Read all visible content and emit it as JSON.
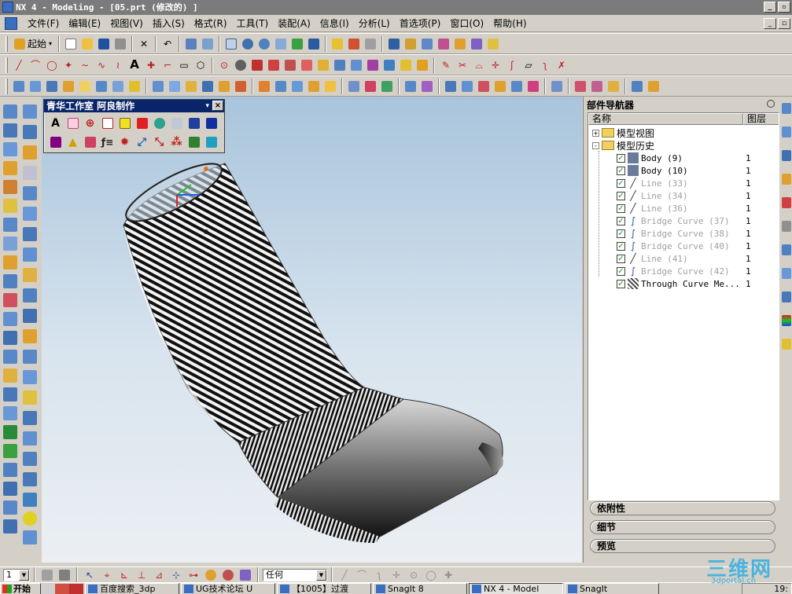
{
  "window": {
    "title": "NX 4 - Modeling - [05.prt (修改的) ]",
    "minimize_label": "_",
    "restore_label": "▫"
  },
  "menu": {
    "items": [
      {
        "label": "文件(F)"
      },
      {
        "label": "编辑(E)"
      },
      {
        "label": "视图(V)"
      },
      {
        "label": "插入(S)"
      },
      {
        "label": "格式(R)"
      },
      {
        "label": "工具(T)"
      },
      {
        "label": "装配(A)"
      },
      {
        "label": "信息(I)"
      },
      {
        "label": "分析(L)"
      },
      {
        "label": "首选项(P)"
      },
      {
        "label": "窗口(O)"
      },
      {
        "label": "帮助(H)"
      }
    ]
  },
  "toolbar": {
    "start_label": "起始",
    "text_tool_label": "A"
  },
  "floating_palette": {
    "title": "青华工作室 阿良制作",
    "text_tool_label": "A",
    "close_label": "×",
    "dropdown_label": "▾"
  },
  "navigator": {
    "title": "部件导航器",
    "columns": {
      "name": "名称",
      "layer": "图层"
    },
    "tree": [
      {
        "label": "模型视图",
        "kind": "folder",
        "expander": "+",
        "level": 0,
        "layer": "",
        "dim": false
      },
      {
        "label": "模型历史",
        "kind": "folder",
        "expander": "-",
        "level": 0,
        "layer": "",
        "dim": false
      },
      {
        "label": "Body (9)",
        "kind": "body",
        "expander": "",
        "level": 1,
        "layer": "1",
        "dim": false
      },
      {
        "label": "Body (10)",
        "kind": "body",
        "expander": "",
        "level": 1,
        "layer": "1",
        "dim": false
      },
      {
        "label": "Line (33)",
        "kind": "line",
        "expander": "",
        "level": 1,
        "layer": "1",
        "dim": true
      },
      {
        "label": "Line (34)",
        "kind": "line",
        "expander": "",
        "level": 1,
        "layer": "1",
        "dim": true
      },
      {
        "label": "Line (36)",
        "kind": "line",
        "expander": "",
        "level": 1,
        "layer": "1",
        "dim": true
      },
      {
        "label": "Bridge Curve (37)",
        "kind": "bridge",
        "expander": "",
        "level": 1,
        "layer": "1",
        "dim": true
      },
      {
        "label": "Bridge Curve (38)",
        "kind": "bridge",
        "expander": "",
        "level": 1,
        "layer": "1",
        "dim": true
      },
      {
        "label": "Bridge Curve (40)",
        "kind": "bridge",
        "expander": "",
        "level": 1,
        "layer": "1",
        "dim": true
      },
      {
        "label": "Line (41)",
        "kind": "line",
        "expander": "",
        "level": 1,
        "layer": "1",
        "dim": true
      },
      {
        "label": "Bridge Curve (42)",
        "kind": "bridge",
        "expander": "",
        "level": 1,
        "layer": "1",
        "dim": true
      },
      {
        "label": "Through Curve Me...",
        "kind": "mesh",
        "expander": "",
        "level": 1,
        "layer": "1",
        "dim": false
      }
    ],
    "sections": [
      {
        "label": "依附性"
      },
      {
        "label": "细节"
      },
      {
        "label": "预览"
      }
    ]
  },
  "bottombar": {
    "layer_value": "1",
    "filter_value": "任何"
  },
  "taskbar": {
    "start_label": "开始",
    "tasks": [
      {
        "label": "百度搜索_3dp",
        "active": false
      },
      {
        "label": "UG技术论坛 U",
        "active": false
      },
      {
        "label": "【1005】过渡",
        "active": false
      },
      {
        "label": "SnagIt 8",
        "active": false
      },
      {
        "label": "NX 4 - Model",
        "active": true
      },
      {
        "label": "SnagIt",
        "active": false
      }
    ],
    "clock": "19:"
  },
  "watermark": {
    "text": "三维网",
    "sub": "3dportal.cn"
  },
  "colors": {
    "title_bg": "#7b7b7b",
    "palette_head": "#0a246a",
    "viewport_top": "#a8c4dc",
    "viewport_bottom": "#ebeff3",
    "check_green": "#1a9a1a"
  }
}
